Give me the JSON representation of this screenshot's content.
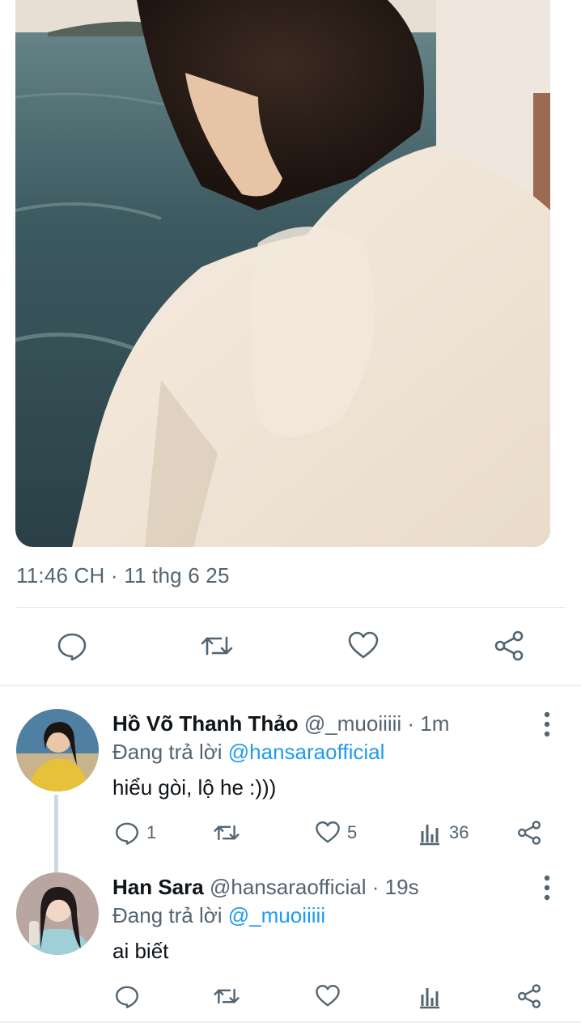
{
  "tweet": {
    "timestamp": "11:46 CH · 11 thg 6 25",
    "photo_alt_icon": "photo",
    "actions": [
      {
        "name": "reply",
        "icon": "reply-icon"
      },
      {
        "name": "retweet",
        "icon": "retweet-icon"
      },
      {
        "name": "like",
        "icon": "heart-icon"
      },
      {
        "name": "share",
        "icon": "share-icon"
      }
    ]
  },
  "replies": [
    {
      "display_name": "Hồ Võ Thanh Thảo",
      "meta": "@_muoiiiii · 1m",
      "replying_prefix": "Đang trả lời ",
      "replying_to": "@hansaraofficial",
      "text": "hiểu gòi, lộ he :)))",
      "reply_count": "1",
      "like_count": "5",
      "view_count": "36"
    },
    {
      "display_name": "Han Sara",
      "meta": "@hansaraofficial · 19s",
      "replying_prefix": "Đang trả lời ",
      "replying_to": "@_muoiiiii",
      "text": "ai biết",
      "reply_count": "",
      "like_count": "",
      "view_count": ""
    }
  ],
  "colors": {
    "text_primary": "#0f1419",
    "text_secondary": "#536471",
    "link": "#1d9bf0",
    "icon": "#536471"
  }
}
